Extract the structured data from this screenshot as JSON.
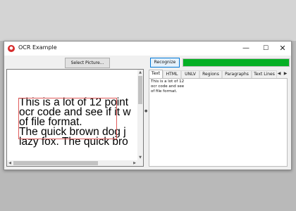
{
  "window": {
    "title": "OCR Example",
    "app_icon": "app-logo-icon",
    "controls": {
      "minimize": "—",
      "maximize": "☐",
      "close": "✕"
    }
  },
  "left": {
    "select_button": "Select Picture...",
    "image_text_lines": [
      "This is a lot of 12 point",
      "ocr code and see if it w",
      "of file format.",
      "The quick brown dog j",
      "lazy fox. The quick bro"
    ]
  },
  "right": {
    "recognize_button": "Recognize",
    "progress_fraction": 1.0,
    "tabs": [
      "Text",
      "HTML",
      "UNLV",
      "Regions",
      "Paragraphs",
      "Text Lines"
    ],
    "active_tab": "Text",
    "output_lines": [
      "This is a lot of 12",
      "ocr code and see",
      "of file format."
    ]
  },
  "colors": {
    "progress": "#06b025",
    "ocr_box": "#e05a5a",
    "recognize_border": "#0078d7"
  }
}
